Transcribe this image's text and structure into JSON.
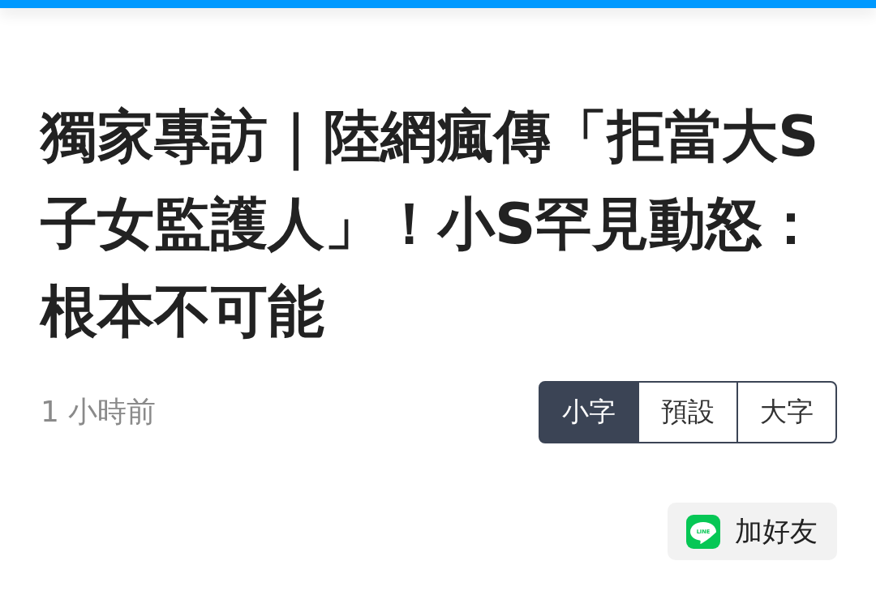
{
  "article": {
    "title": "獨家專訪｜陸網瘋傳「拒當大S子女監護人」！小S罕見動怒：根本不可能",
    "time": "1 小時前"
  },
  "font_size_options": [
    {
      "label": "小字",
      "selected": true
    },
    {
      "label": "預設",
      "selected": false
    },
    {
      "label": "大字",
      "selected": false
    }
  ],
  "line_button": {
    "logo_text": "LINE",
    "label": "加好友"
  }
}
